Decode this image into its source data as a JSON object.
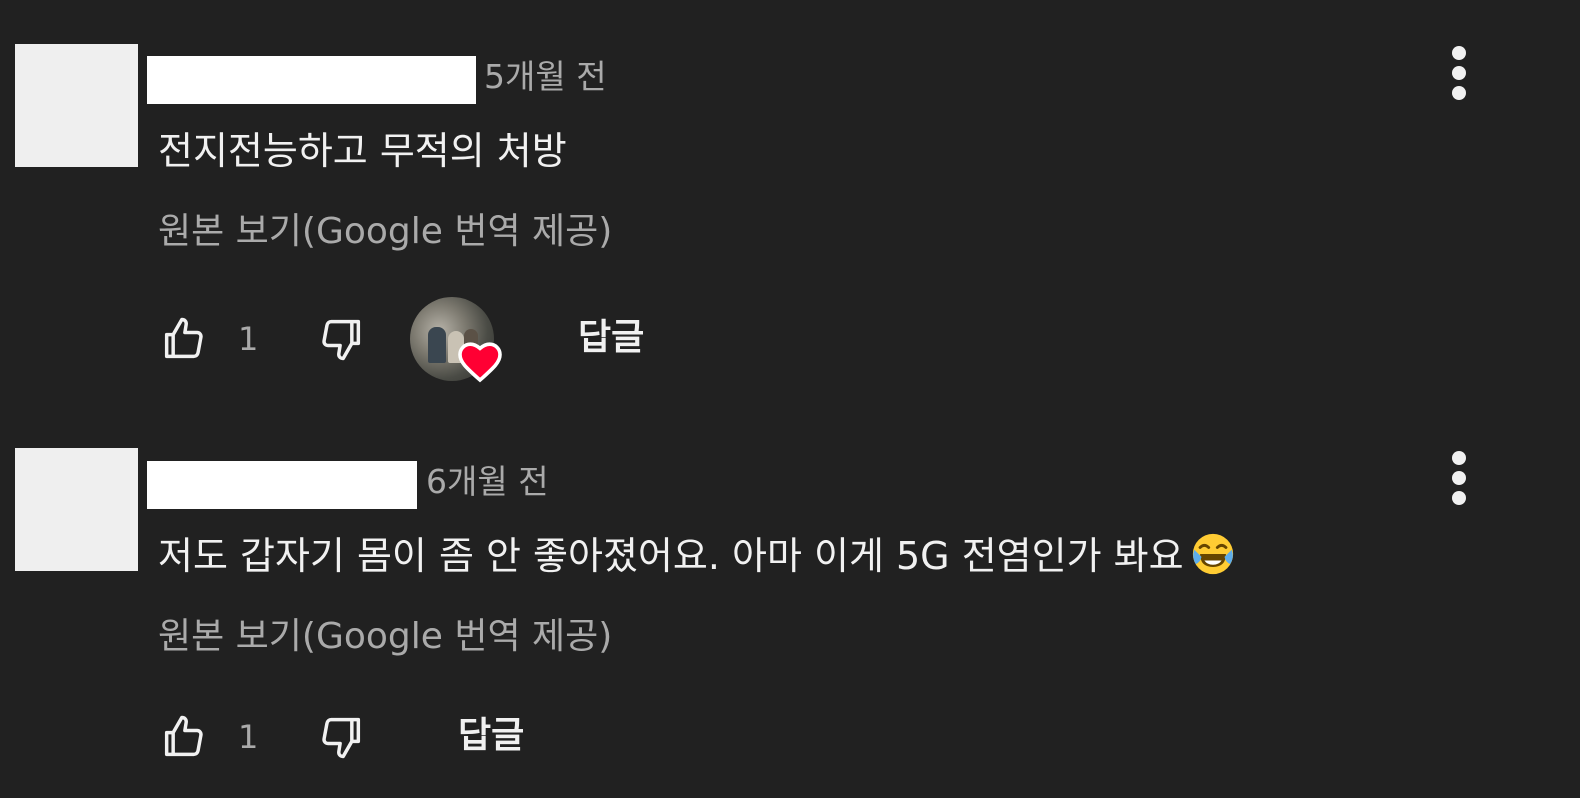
{
  "comments": [
    {
      "time": "5개월 전",
      "text": "전지전능하고 무적의 처방",
      "translate_label": "원본 보기(Google 번역 제공)",
      "like_count": "1",
      "creator_hearted": true,
      "reply_label": "답글"
    },
    {
      "time": "6개월 전",
      "text": "저도 갑자기 몸이 좀 안 좋아졌어요. 아마 이게 5G 전염인가 봐요",
      "emoji": "face-with-tears-of-joy",
      "translate_label": "원본 보기(Google 번역 제공)",
      "like_count": "1",
      "creator_hearted": false,
      "reply_label": "답글"
    }
  ],
  "icons": {
    "like": "thumbs-up-icon",
    "dislike": "thumbs-down-icon",
    "more": "more-vertical-icon",
    "heart": "heart-icon"
  },
  "colors": {
    "background": "#212121",
    "text": "#f1f1f1",
    "secondary_text": "#aaaaaa",
    "heart": "#ff0033"
  }
}
